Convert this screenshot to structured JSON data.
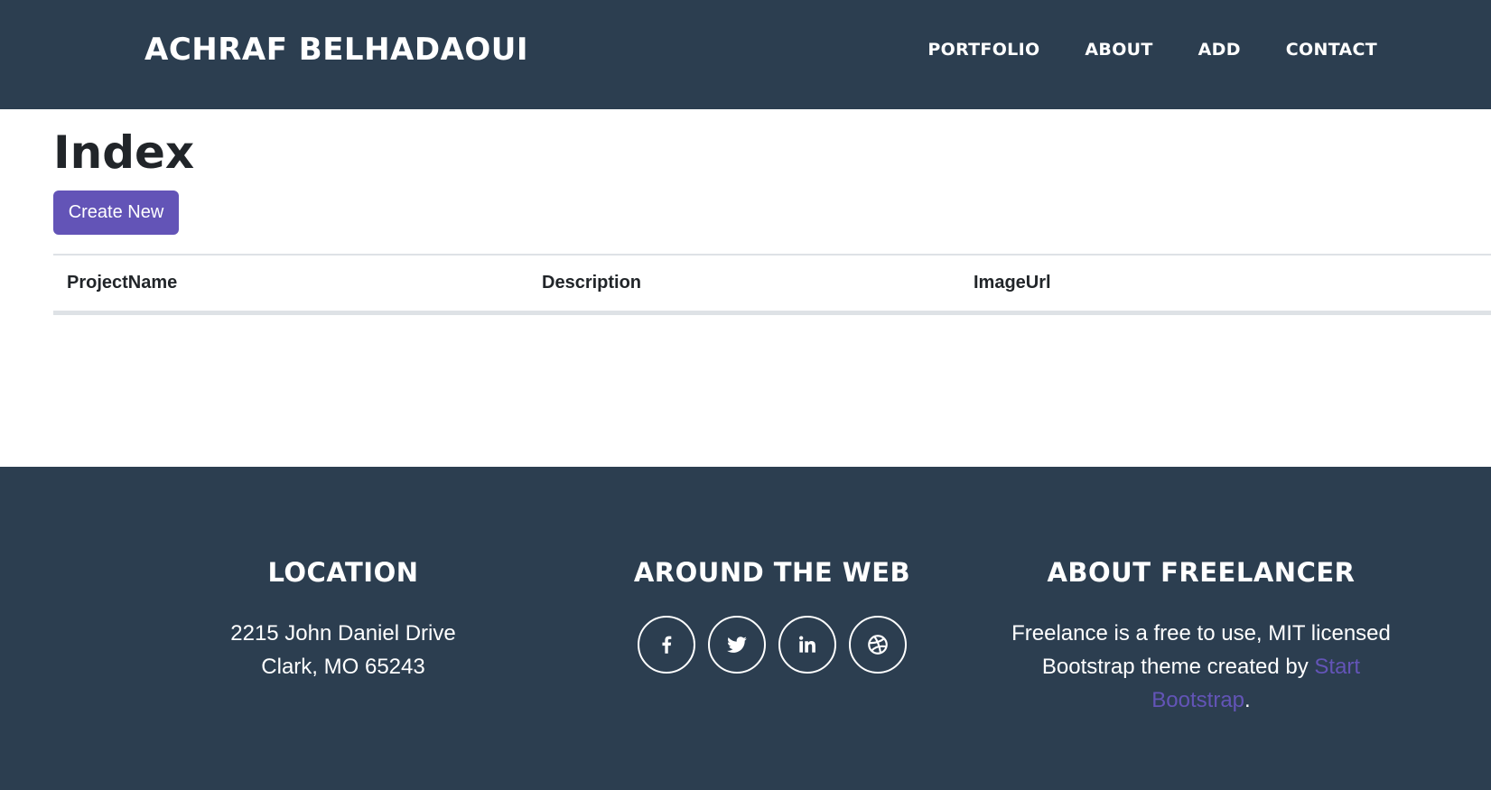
{
  "navbar": {
    "brand": "ACHRAF BELHADAOUI",
    "items": [
      {
        "label": "PORTFOLIO"
      },
      {
        "label": "ABOUT"
      },
      {
        "label": "ADD"
      },
      {
        "label": "CONTACT"
      }
    ]
  },
  "main": {
    "title": "Index",
    "create_label": "Create New",
    "table": {
      "headers": [
        "ProjectName",
        "Description",
        "ImageUrl"
      ]
    }
  },
  "footer": {
    "location": {
      "title": "LOCATION",
      "line1": "2215 John Daniel Drive",
      "line2": "Clark, MO 65243"
    },
    "web": {
      "title": "AROUND THE WEB",
      "icons": [
        "facebook-icon",
        "twitter-icon",
        "linkedin-icon",
        "dribbble-icon"
      ]
    },
    "about": {
      "title": "ABOUT FREELANCER",
      "text": "Freelance is a free to use, MIT licensed Bootstrap theme created by",
      "link": "Start Bootstrap",
      "end": "."
    }
  },
  "colors": {
    "navbar_bg": "#2c3e50",
    "accent": "#6354b7",
    "text": "#212529",
    "border": "#dee2e6"
  }
}
